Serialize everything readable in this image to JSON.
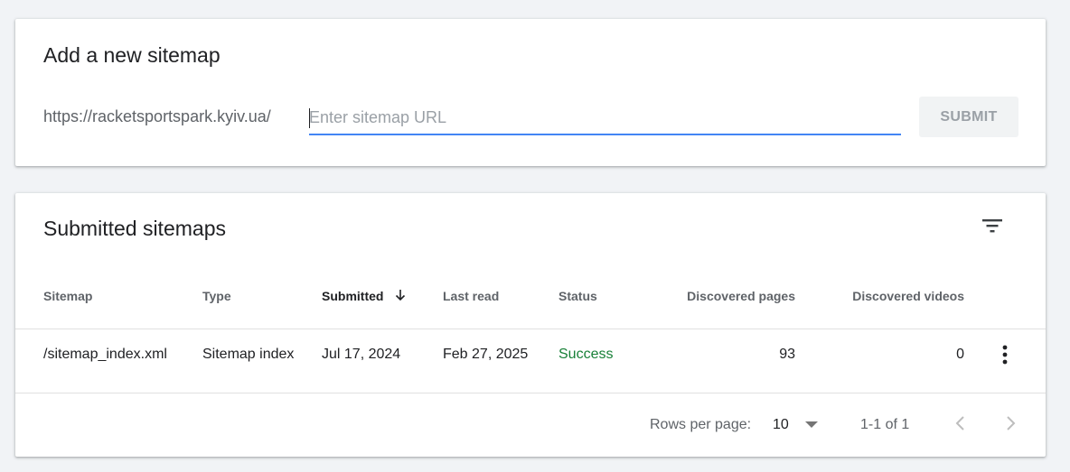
{
  "add_sitemap": {
    "title": "Add a new sitemap",
    "url_prefix": "https://racketsportspark.kyiv.ua/",
    "input_placeholder": "Enter sitemap URL",
    "input_value": "",
    "submit_label": "SUBMIT"
  },
  "submitted": {
    "title": "Submitted sitemaps",
    "filter_icon": "filter-list-icon",
    "columns": {
      "sitemap": "Sitemap",
      "type": "Type",
      "submitted": "Submitted",
      "last_read": "Last read",
      "status": "Status",
      "discovered_pages": "Discovered pages",
      "discovered_videos": "Discovered videos"
    },
    "sort": {
      "column": "submitted",
      "direction": "descending",
      "icon": "arrow-downward-icon"
    },
    "rows": [
      {
        "sitemap": "/sitemap_index.xml",
        "type": "Sitemap index",
        "submitted": "Jul 17, 2024",
        "last_read": "Feb 27, 2025",
        "status": "Success",
        "discovered_pages": "93",
        "discovered_videos": "0"
      }
    ],
    "pagination": {
      "rows_per_page_label": "Rows per page:",
      "rows_per_page_value": "10",
      "range_text": "1-1 of 1"
    }
  },
  "colors": {
    "accent": "#4285f4",
    "status_success": "#188038",
    "background": "#f1f3f6"
  }
}
